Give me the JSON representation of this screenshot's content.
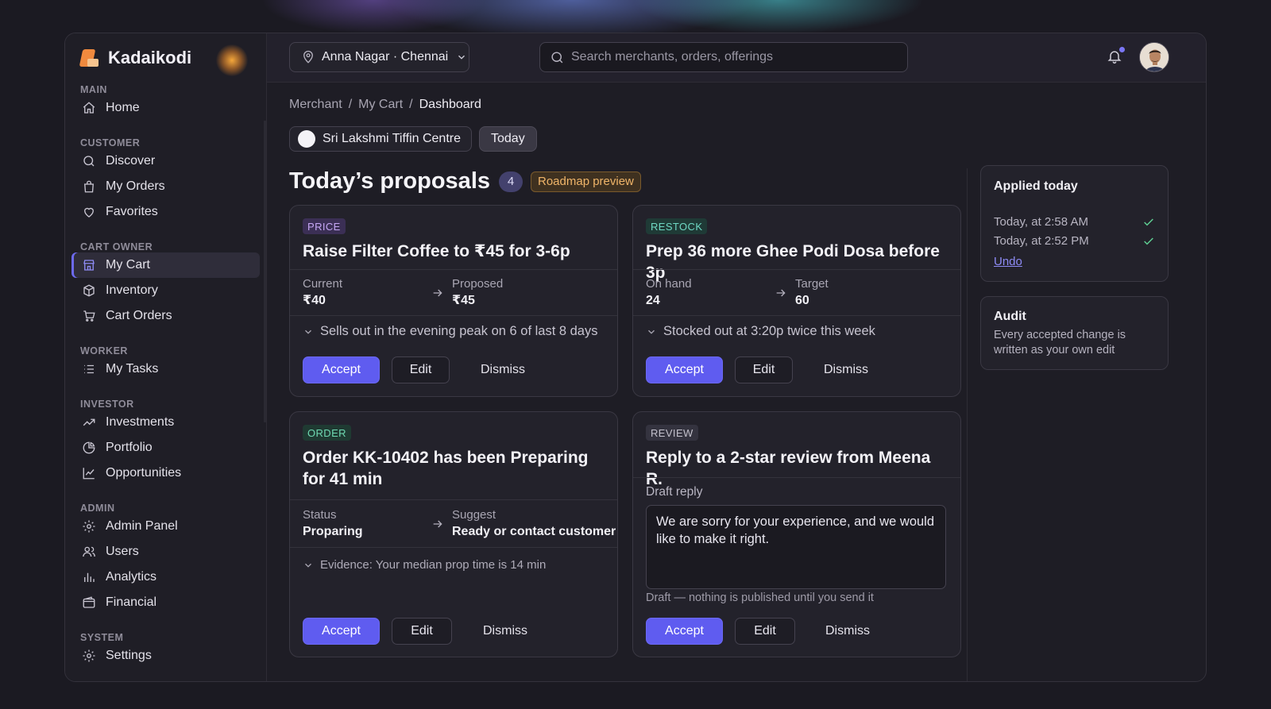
{
  "app": {
    "name": "Kadaikodi"
  },
  "sidebar": {
    "sections": [
      {
        "label": "MAIN",
        "items": [
          {
            "label": "Home",
            "icon": "home-icon"
          }
        ]
      },
      {
        "label": "CUSTOMER",
        "items": [
          {
            "label": "Discover",
            "icon": "search-icon"
          },
          {
            "label": "My Orders",
            "icon": "shopping-bag-icon"
          },
          {
            "label": "Favorites",
            "icon": "heart-icon"
          }
        ]
      },
      {
        "label": "CART OWNER",
        "items": [
          {
            "label": "My Cart",
            "icon": "storefront-icon",
            "active": true
          },
          {
            "label": "Inventory",
            "icon": "package-icon"
          },
          {
            "label": "Cart Orders",
            "icon": "cart-icon"
          }
        ]
      },
      {
        "label": "WORKER",
        "items": [
          {
            "label": "My Tasks",
            "icon": "list-icon"
          }
        ]
      },
      {
        "label": "INVESTOR",
        "items": [
          {
            "label": "Investments",
            "icon": "trending-up-icon"
          },
          {
            "label": "Portfolio",
            "icon": "pie-chart-icon"
          },
          {
            "label": "Opportunities",
            "icon": "line-chart-icon"
          }
        ]
      },
      {
        "label": "ADMIN",
        "items": [
          {
            "label": "Admin Panel",
            "icon": "gear-icon"
          },
          {
            "label": "Users",
            "icon": "users-icon"
          },
          {
            "label": "Analytics",
            "icon": "bar-chart-icon"
          },
          {
            "label": "Financial",
            "icon": "wallet-icon"
          }
        ]
      },
      {
        "label": "SYSTEM",
        "items": [
          {
            "label": "Settings",
            "icon": "gear-icon"
          }
        ]
      }
    ]
  },
  "topbar": {
    "location": "Anna Nagar · Chennai",
    "search_placeholder": "Search merchants, orders, offerings"
  },
  "breadcrumb": {
    "items": [
      "Merchant",
      "My Cart",
      "Dashboard"
    ],
    "separator": "/"
  },
  "chips": {
    "merchant": "Sri Lakshmi Tiffin Centre",
    "period": "Today"
  },
  "proposals": {
    "title": "Today’s proposals",
    "count": "4",
    "badge": "Roadmap preview",
    "cards": [
      {
        "tag": "PRICE",
        "title": "Raise Filter Coffee to ₹45 for 3-6p",
        "left_key": "Current",
        "left_value": "₹40",
        "right_key": "Proposed",
        "right_value": "₹45",
        "reason": "Sells out in the evening peak on 6 of last 8 days",
        "accept": "Accept",
        "edit": "Edit",
        "dismiss": "Dismiss"
      },
      {
        "tag": "RESTOCK",
        "title": "Prep 36 more Ghee Podi Dosa before 3p",
        "left_key": "On hand",
        "left_value": "24",
        "right_key": "Target",
        "right_value": "60",
        "reason": "Stocked out at 3:20p twice this week",
        "accept": "Accept",
        "edit": "Edit",
        "dismiss": "Dismiss"
      },
      {
        "tag": "ORDER",
        "title": "Order KK-10402 has been Preparing for 41 min",
        "left_key": "Status",
        "left_value": "Proparing",
        "right_key": "Suggest",
        "right_value": "Ready or contact customer",
        "reason": "Evidence: Your median prop time is 14 min",
        "accept": "Accept",
        "edit": "Edit",
        "dismiss": "Dismiss"
      },
      {
        "tag": "REVIEW",
        "title": "Reply to a 2-star review from Meena R.",
        "draft_label": "Draft reply",
        "draft_text": "We are sorry for your experience, and we would like to make it right.",
        "draft_note": "Draft — nothing is published until you send it",
        "accept": "Accept",
        "edit": "Edit",
        "dismiss": "Dismiss"
      }
    ]
  },
  "applied_today": {
    "title": "Applied today",
    "entries": [
      "Today, at 2:58 AM",
      "Today, at 2:52 PM"
    ],
    "undo": "Undo"
  },
  "audit": {
    "title": "Audit",
    "text": "Every accepted change is written as your own edit"
  },
  "colors": {
    "accent": "#5f5cf0",
    "background": "#1b1a22",
    "card": "#23222b",
    "price_tag": "#c6a7f5",
    "restock_tag": "#6fd9c4",
    "roadmap_badge": "#f0b569",
    "success": "#5fcf93"
  }
}
